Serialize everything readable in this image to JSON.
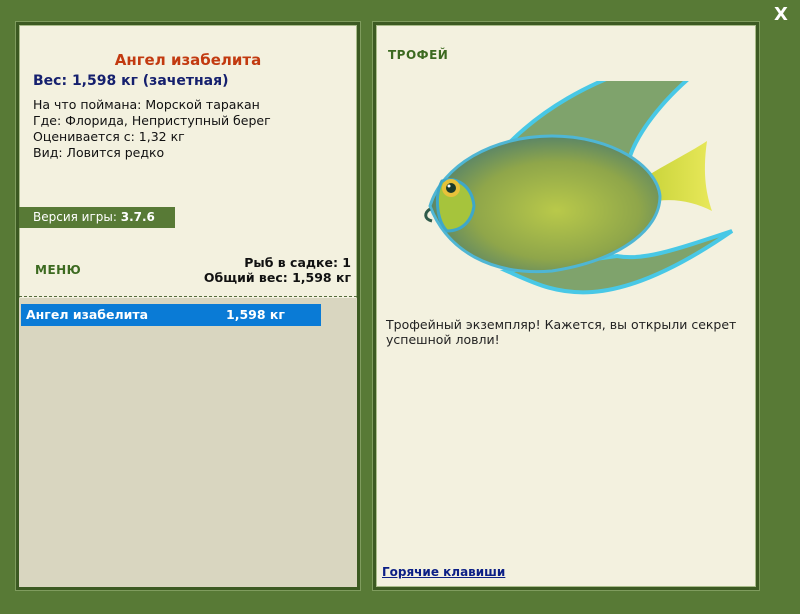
{
  "window": {
    "close_label": "X"
  },
  "fish": {
    "title": "Ангел изабелита",
    "weight_line": "Вес: 1,598 кг (зачетная)",
    "bait_label": "На что поймана:",
    "bait_value": "Морской таракан",
    "place_label": "Где:",
    "place_value": "Флорида, Неприступный берег",
    "price_label": "Оценивается с:",
    "price_value": "1,32 кг",
    "kind_label": "Вид:",
    "kind_value": "Ловится редко"
  },
  "version": {
    "label": "Версия игры:",
    "value": "3.7.6"
  },
  "menu": {
    "label": "МЕНЮ"
  },
  "keep_net": {
    "count_label": "Рыб в садке: 1",
    "total_label": "Общий вес: 1,598 кг",
    "items": [
      {
        "name": "Ангел изабелита",
        "weight": "1,598 кг"
      }
    ]
  },
  "trophy": {
    "title": "ТРОФЕЙ",
    "description": "Трофейный экземпляр! Кажется, вы открыли секрет успешной ловли!",
    "hotkeys_label": "Горячие клавиши"
  },
  "colors": {
    "background": "#587a36",
    "panel": "#f3f1df",
    "title_red": "#c23a10",
    "weight_blue": "#15206e",
    "selection": "#0a7bd6",
    "link": "#0b1f86"
  },
  "icons": {
    "close": "close-icon",
    "fish": "angelfish-image"
  }
}
